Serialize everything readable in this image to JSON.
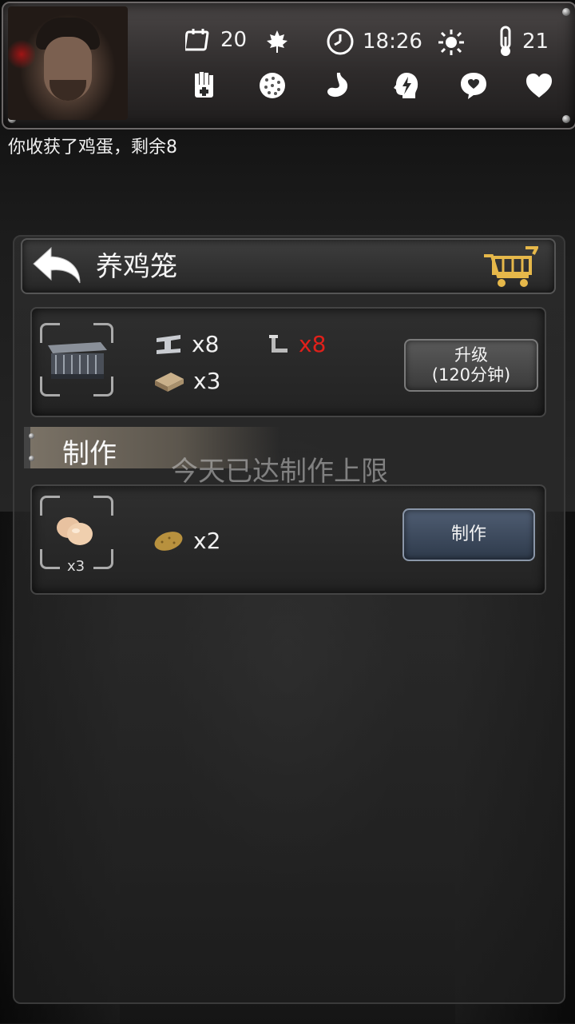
{
  "hud": {
    "day": "20",
    "season_icon": "maple-leaf-icon",
    "time": "18:26",
    "weather_icon": "sun-icon",
    "temperature": "21",
    "status_icons": [
      "bandage-hand-icon",
      "sickness-icon",
      "stomach-icon",
      "energy-head-icon",
      "mood-icon",
      "heart-icon"
    ]
  },
  "message": "你收获了鸡蛋，剩余8",
  "panel": {
    "title": "养鸡笼",
    "back_icon": "back-arrow-icon",
    "cart_icon": "shopping-cart-icon"
  },
  "upgrade": {
    "item_icon": "chicken-coop-icon",
    "requirements": [
      {
        "icon": "steel-beam-icon",
        "text": "x8",
        "color": "#f1f1f1"
      },
      {
        "icon": "pipe-icon",
        "text": "x8",
        "color": "#e0201a"
      },
      {
        "icon": "wood-plank-icon",
        "text": "x3",
        "color": "#f1f1f1"
      }
    ],
    "button_line1": "升级",
    "button_line2": "(120分钟)"
  },
  "craft": {
    "section_label": "制作",
    "limit_text": "今天已达制作上限",
    "product_icon": "eggs-icon",
    "product_qty": "x3",
    "ingredient_icon": "potato-icon",
    "ingredient_text": "x2",
    "button_label": "制作"
  }
}
